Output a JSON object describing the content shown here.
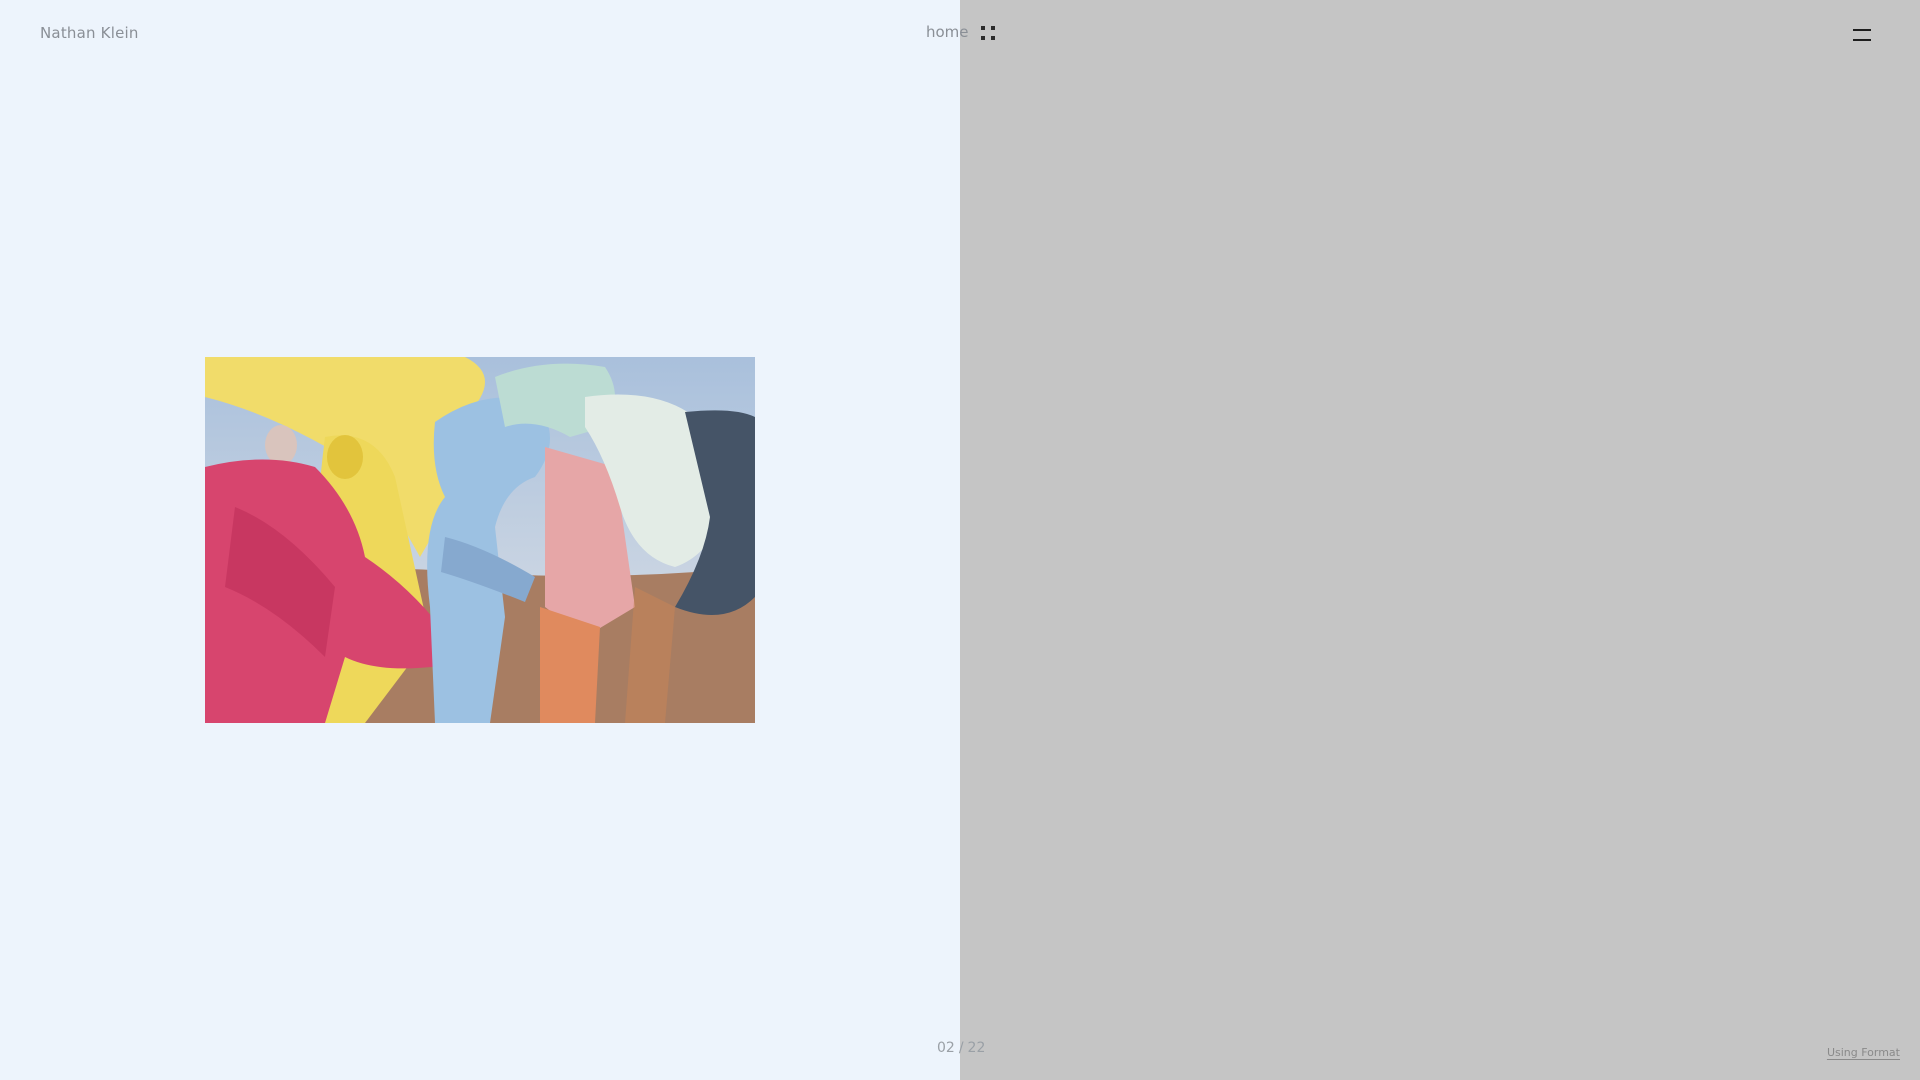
{
  "header": {
    "site_title": "Nathan Klein",
    "home_label": "home"
  },
  "icons": {
    "grid": "grid-view-icon",
    "menu": "hamburger-menu-icon"
  },
  "colors": {
    "left_panel_bg": "#edf4fc",
    "right_panel_bg": "#c5c5c5",
    "text_muted": "#8a8f96"
  },
  "gallery": {
    "current": "02",
    "separator": "/",
    "total": "22"
  },
  "footer": {
    "link_label": "Using Format"
  }
}
